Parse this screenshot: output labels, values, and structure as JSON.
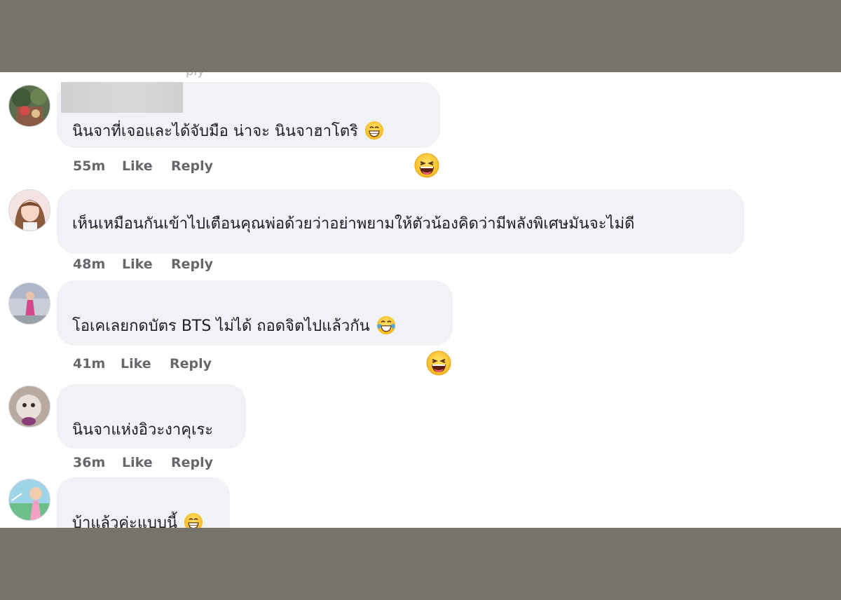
{
  "colors": {
    "bubble": "#f0f2f5",
    "meta_text": "#65676b",
    "comment_text": "#1c1e21",
    "frame": "#76736a"
  },
  "top_cutoff_text": "ply",
  "comments": [
    {
      "text": "นินจาที่เจอและได้จับมือ น่าจะ นินจาฮาโตริ",
      "time": "55m",
      "like": "Like",
      "reply": "Reply",
      "name_redacted": true,
      "inline_emoji": "grinning-face-icon",
      "reaction": "laughing-face-icon"
    },
    {
      "text": "เห็นเหมือนกันเข้าไปเตือนคุณพ่อด้วยว่าอย่าพยามให้ตัวน้องคิดว่ามีพลังพิเศษมันจะไม่ดี",
      "time": "48m",
      "like": "Like",
      "reply": "Reply"
    },
    {
      "text": "โอเคเลยกดบัตร BTS ไม่ได้ ถอดจิตไปแล้วกัน",
      "time": "41m",
      "like": "Like",
      "reply": "Reply",
      "inline_emoji": "tears-of-joy-icon",
      "reaction": "laughing-face-icon"
    },
    {
      "text": "นินจาแห่งอิวะงาคุเระ",
      "time": "36m",
      "like": "Like",
      "reply": "Reply"
    },
    {
      "text": "บ้าแล้วค่ะแบบนี้",
      "inline_emoji": "grinning-face-icon"
    }
  ]
}
